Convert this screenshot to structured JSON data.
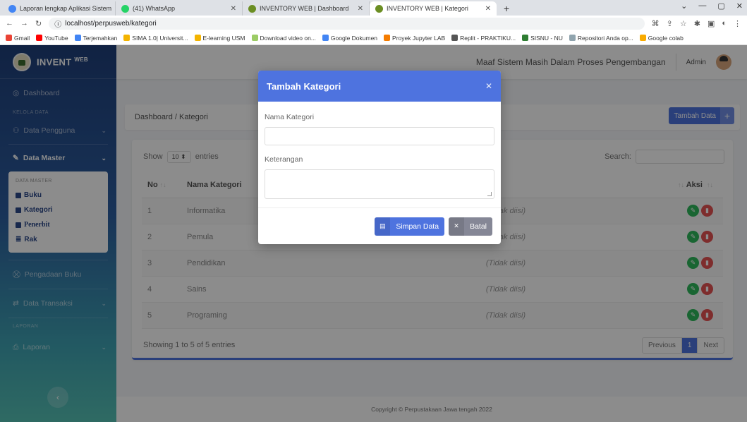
{
  "browser": {
    "tabs": [
      {
        "label": "Laporan lengkap Aplikasi Sistem",
        "color": "#4285f4"
      },
      {
        "label": "(41) WhatsApp",
        "color": "#25d366"
      },
      {
        "label": "INVENTORY WEB | Dashboard",
        "color": "#6b8e23"
      },
      {
        "label": "INVENTORY WEB | Kategori",
        "color": "#6b8e23"
      }
    ],
    "url": "localhost/perpusweb/kategori",
    "bookmarks": [
      {
        "label": "Gmail",
        "color": "#ea4335"
      },
      {
        "label": "YouTube",
        "color": "#ff0000"
      },
      {
        "label": "Terjemahkan",
        "color": "#4285f4"
      },
      {
        "label": "SIMA 1.0| Universit...",
        "color": "#f4b400"
      },
      {
        "label": "E-learning USM",
        "color": "#f4b400"
      },
      {
        "label": "Download video on...",
        "color": "#9ccc65"
      },
      {
        "label": "Google Dokumen",
        "color": "#4285f4"
      },
      {
        "label": "Proyek Jupyter LAB",
        "color": "#f57c00"
      },
      {
        "label": "Replit - PRAKTIKU...",
        "color": "#555555"
      },
      {
        "label": "SISNU - NU",
        "color": "#2e7d32"
      },
      {
        "label": "Repositori Anda op...",
        "color": "#90a4ae"
      },
      {
        "label": "Google colab",
        "color": "#f9ab00"
      }
    ]
  },
  "sidebar": {
    "brand": "INVENT",
    "brand_sup": "WEB",
    "dashboard": "Dashboard",
    "sec_kelola": "KELOLA DATA",
    "data_pengguna": "Data Pengguna",
    "data_master": "Data Master",
    "sub_header": "DATA MASTER",
    "sub_items": [
      "Buku",
      "Kategori",
      "Penerbit",
      "Rak"
    ],
    "pengadaan": "Pengadaan Buku",
    "transaksi": "Data Transaksi",
    "sec_laporan": "LAPORAN",
    "laporan": "Laporan"
  },
  "topbar": {
    "notice": "Maaf Sistem Masih Dalam Proses Pengembangan",
    "user": "Admin"
  },
  "breadcrumb": "Dashboard / Kategori",
  "add_button": "Tambah Data",
  "table": {
    "show": "Show",
    "entries_value": "10",
    "entries": "entries",
    "search_label": "Search:",
    "headers": [
      "No",
      "Nama Kategori",
      "Keterangan",
      "Aksi"
    ],
    "rows": [
      {
        "no": "1",
        "nama": "Informatika",
        "ket": "(Tidak diisi)"
      },
      {
        "no": "2",
        "nama": "Pemula",
        "ket": "(Tidak diisi)"
      },
      {
        "no": "3",
        "nama": "Pendidikan",
        "ket": "(Tidak diisi)"
      },
      {
        "no": "4",
        "nama": "Sains",
        "ket": "(Tidak diisi)"
      },
      {
        "no": "5",
        "nama": "Programing",
        "ket": "(Tidak diisi)"
      }
    ],
    "info": "Showing 1 to 5 of 5 entries",
    "prev": "Previous",
    "page": "1",
    "next": "Next"
  },
  "footer": "Copyright © Perpustakaan Jawa tengah 2022",
  "modal": {
    "title": "Tambah Kategori",
    "label_nama": "Nama Kategori",
    "label_ket": "Keterangan",
    "save": "Simpan Data",
    "cancel": "Batal"
  },
  "colors": {
    "primary": "#4e73df",
    "success": "#2eb85c",
    "danger": "#e55353",
    "secondary": "#858796"
  }
}
